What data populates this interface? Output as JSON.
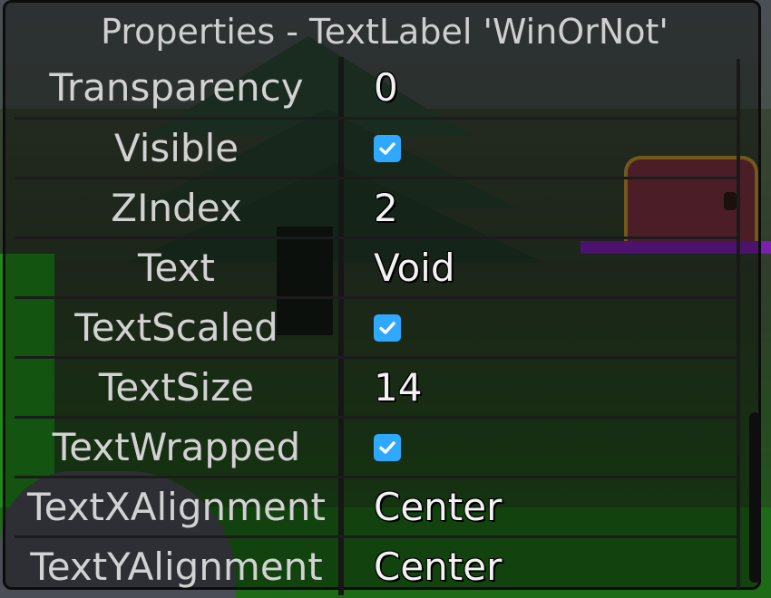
{
  "window": {
    "title": "Properties - TextLabel 'WinOrNot'"
  },
  "properties": [
    {
      "name": "Transparency",
      "value": "0",
      "type": "number"
    },
    {
      "name": "Visible",
      "value": "true",
      "type": "checkbox"
    },
    {
      "name": "ZIndex",
      "value": "2",
      "type": "number"
    },
    {
      "name": "Text",
      "value": "Void",
      "type": "text"
    },
    {
      "name": "TextScaled",
      "value": "true",
      "type": "checkbox"
    },
    {
      "name": "TextSize",
      "value": "14",
      "type": "number"
    },
    {
      "name": "TextWrapped",
      "value": "true",
      "type": "checkbox"
    },
    {
      "name": "TextXAlignment",
      "value": "Center",
      "type": "text"
    },
    {
      "name": "TextYAlignment",
      "value": "Center",
      "type": "text"
    }
  ],
  "colors": {
    "checkbox": "#2fa8ff",
    "title_text": "#cfcfcf",
    "value_text": "#f2f2f2"
  }
}
